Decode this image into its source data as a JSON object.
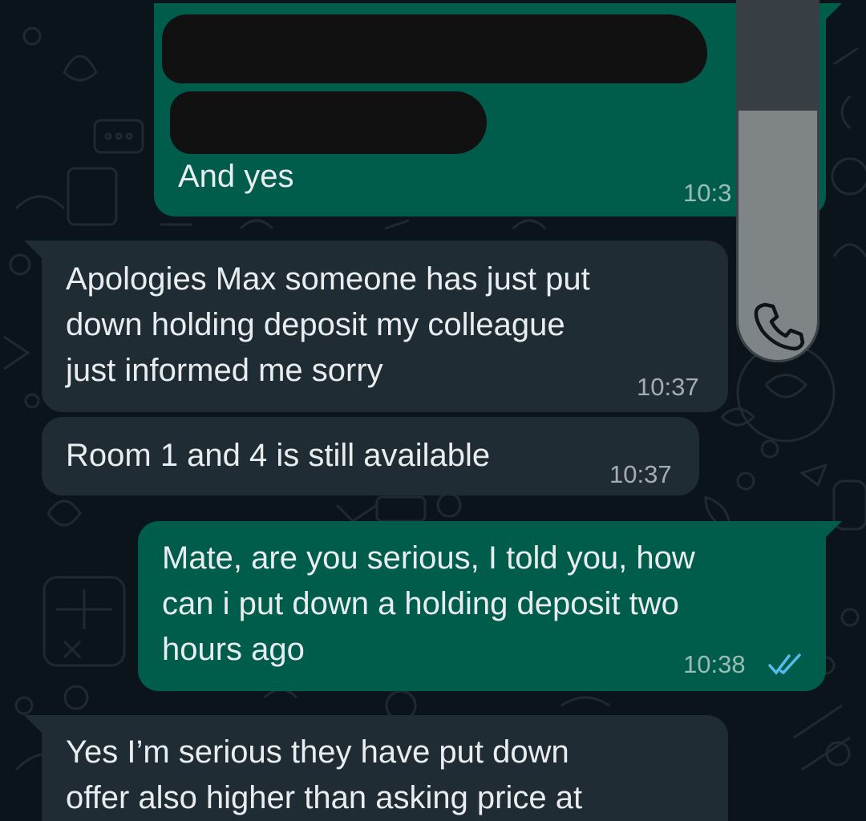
{
  "chat": {
    "messages": [
      {
        "id": "m1",
        "direction": "outgoing",
        "visible_text": "And yes",
        "time": "10:3",
        "redacted": true
      },
      {
        "id": "m2",
        "direction": "incoming",
        "text": "Apologies Max someone has just put\ndown holding deposit my colleague\njust informed me sorry",
        "time": "10:37"
      },
      {
        "id": "m3",
        "direction": "incoming",
        "text": "Room 1 and 4 is still available",
        "time": "10:37"
      },
      {
        "id": "m4",
        "direction": "outgoing",
        "text": "Mate, are you serious, I told you, how\ncan i put down a holding deposit two\nhours ago",
        "time": "10:38",
        "status": "read",
        "status_icon": "double-check-icon"
      },
      {
        "id": "m5",
        "direction": "incoming",
        "text": "Yes I’m serious they have put down\noffer also higher than asking price at",
        "time": ""
      }
    ]
  },
  "scrollbar": {
    "icon": "phone-icon"
  },
  "colors": {
    "background": "#0b141a",
    "incoming_bubble": "#202c33",
    "outgoing_bubble": "#005c4b",
    "text": "#e9edef",
    "read_ticks": "#53bdeb"
  }
}
